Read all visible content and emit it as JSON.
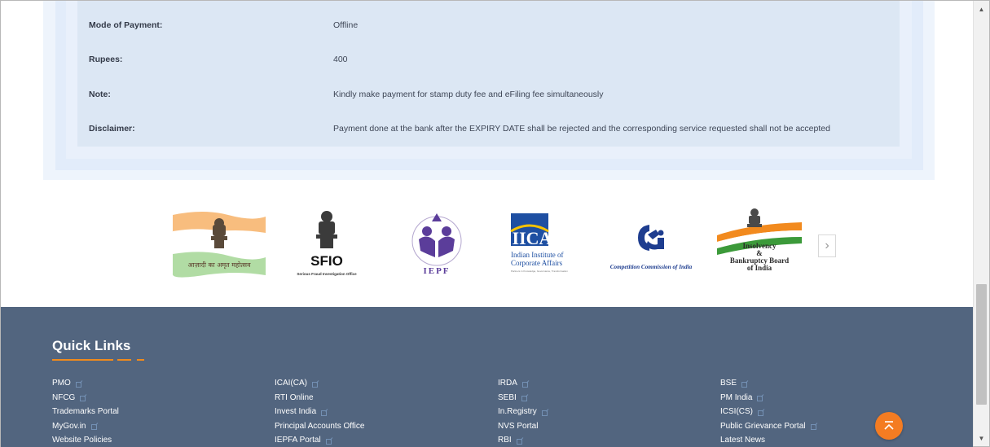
{
  "details": [
    {
      "label": "Mode of Payment:",
      "value": "Offline"
    },
    {
      "label": "Rupees:",
      "value": "400"
    },
    {
      "label": "Note:",
      "value": "Kindly make payment for stamp duty fee and eFiling fee simultaneously"
    },
    {
      "label": "Disclaimer:",
      "value": "Payment done at the bank after the EXPIRY DATE shall be rejected and the corresponding service requested shall not be accepted"
    }
  ],
  "logos": {
    "azadi": {
      "text": "आज़ादी का अमृत महोत्सव"
    },
    "sfio": {
      "title": "SFIO",
      "subtitle": "Serious Fraud Investigation Office"
    },
    "iepf": {
      "title": "IEPF",
      "arc": "Investor Education & Protection Fund Authority"
    },
    "iica": {
      "title": "IICA",
      "line1": "Indian Institute of",
      "line2": "Corporate Affairs",
      "tagline": "Partners in Knowledge, Governance, Transformation"
    },
    "cci": {
      "text": "Competition Commission of India"
    },
    "ibbi": {
      "line1": "Insolvency",
      "line2": "&",
      "line3": "Bankruptcy Board",
      "line4": "of India"
    },
    "next_label": "›"
  },
  "footer": {
    "quick_links_title": "Quick Links",
    "columns": [
      [
        {
          "label": "PMO",
          "external": true
        },
        {
          "label": "NFCG",
          "external": true
        },
        {
          "label": "Trademarks Portal",
          "external": false
        },
        {
          "label": "MyGov.in",
          "external": true
        },
        {
          "label": "Website Policies",
          "external": false
        }
      ],
      [
        {
          "label": "ICAI(CA)",
          "external": true
        },
        {
          "label": "RTI Online",
          "external": false
        },
        {
          "label": "Invest India",
          "external": true
        },
        {
          "label": "Principal Accounts Office",
          "external": false
        },
        {
          "label": "IEPFA Portal",
          "external": true
        }
      ],
      [
        {
          "label": "IRDA",
          "external": true
        },
        {
          "label": "SEBI",
          "external": true
        },
        {
          "label": "In.Registry",
          "external": true
        },
        {
          "label": "NVS Portal",
          "external": false
        },
        {
          "label": "RBI",
          "external": true
        }
      ],
      [
        {
          "label": "BSE",
          "external": true
        },
        {
          "label": "PM India",
          "external": true
        },
        {
          "label": "ICSI(CS)",
          "external": true
        },
        {
          "label": "Public Grievance Portal",
          "external": true
        },
        {
          "label": "Latest News",
          "external": false
        }
      ]
    ]
  },
  "colors": {
    "footer_bg": "#52657f",
    "accent_orange": "#f47c22",
    "details_bg": "#dce7f4"
  },
  "icons": {
    "scroll_top": "chevron-double-up-icon",
    "external": "external-link-icon"
  }
}
